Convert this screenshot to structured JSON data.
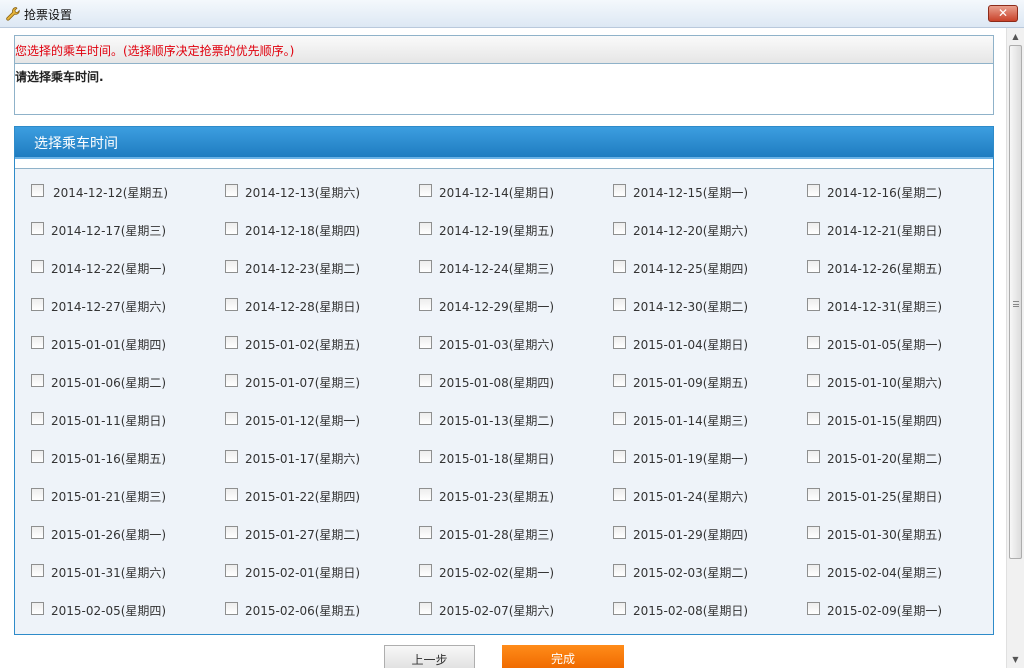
{
  "window": {
    "title": "抢票设置",
    "close_label": "✕",
    "title_icon": "wrench-icon"
  },
  "info": {
    "hint": "您选择的乘车时间。(选择顺序决定抢票的优先顺序。)",
    "placeholder": "请选择乘车时间."
  },
  "panel": {
    "header": "选择乘车时间"
  },
  "dates": [
    [
      "2014-12-12(星期五)",
      "2014-12-13(星期六)",
      "2014-12-14(星期日)",
      "2014-12-15(星期一)",
      "2014-12-16(星期二)"
    ],
    [
      "2014-12-17(星期三)",
      "2014-12-18(星期四)",
      "2014-12-19(星期五)",
      "2014-12-20(星期六)",
      "2014-12-21(星期日)"
    ],
    [
      "2014-12-22(星期一)",
      "2014-12-23(星期二)",
      "2014-12-24(星期三)",
      "2014-12-25(星期四)",
      "2014-12-26(星期五)"
    ],
    [
      "2014-12-27(星期六)",
      "2014-12-28(星期日)",
      "2014-12-29(星期一)",
      "2014-12-30(星期二)",
      "2014-12-31(星期三)"
    ],
    [
      "2015-01-01(星期四)",
      "2015-01-02(星期五)",
      "2015-01-03(星期六)",
      "2015-01-04(星期日)",
      "2015-01-05(星期一)"
    ],
    [
      "2015-01-06(星期二)",
      "2015-01-07(星期三)",
      "2015-01-08(星期四)",
      "2015-01-09(星期五)",
      "2015-01-10(星期六)"
    ],
    [
      "2015-01-11(星期日)",
      "2015-01-12(星期一)",
      "2015-01-13(星期二)",
      "2015-01-14(星期三)",
      "2015-01-15(星期四)"
    ],
    [
      "2015-01-16(星期五)",
      "2015-01-17(星期六)",
      "2015-01-18(星期日)",
      "2015-01-19(星期一)",
      "2015-01-20(星期二)"
    ],
    [
      "2015-01-21(星期三)",
      "2015-01-22(星期四)",
      "2015-01-23(星期五)",
      "2015-01-24(星期六)",
      "2015-01-25(星期日)"
    ],
    [
      "2015-01-26(星期一)",
      "2015-01-27(星期二)",
      "2015-01-28(星期三)",
      "2015-01-29(星期四)",
      "2015-01-30(星期五)"
    ],
    [
      "2015-01-31(星期六)",
      "2015-02-01(星期日)",
      "2015-02-02(星期一)",
      "2015-02-03(星期二)",
      "2015-02-04(星期三)"
    ],
    [
      "2015-02-05(星期四)",
      "2015-02-06(星期五)",
      "2015-02-07(星期六)",
      "2015-02-08(星期日)",
      "2015-02-09(星期一)"
    ]
  ],
  "buttons": {
    "prev": "上一步",
    "done": "完成"
  },
  "colors": {
    "panel_header": "#2585c9",
    "hint_text": "#e0000d",
    "done_button": "#f47a0a"
  }
}
